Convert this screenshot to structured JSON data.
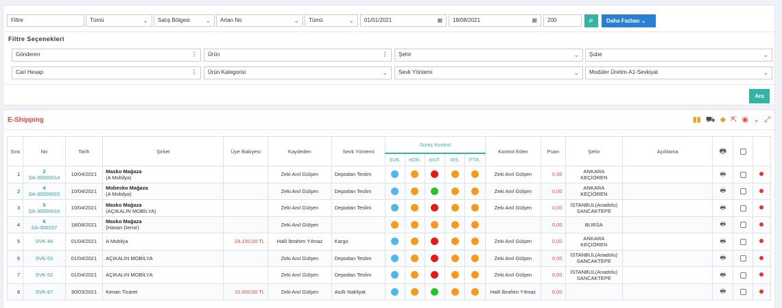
{
  "filters": {
    "text1": "Filtre",
    "all1": "Tümü",
    "region": "Satış Bölgesi",
    "sort": "Artan No",
    "all2": "Tümü",
    "date_from": "01/01/2021",
    "date_to": "18/08/2021",
    "limit": "200",
    "more_label": "Daha Fazlası",
    "search_icon": "search-icon"
  },
  "options": {
    "title": "Filtre Seçenekleri",
    "sender": "Gönderen",
    "product": "Ürün",
    "city": "Şehir",
    "branch": "Şube",
    "account": "Cari Hesap",
    "product_category": "Ürün Kategorisi",
    "shipping_method": "Sevk Yöntemi",
    "module": "Modüler Üretim-A1-Sevkiyat",
    "search_label": "Ara"
  },
  "grid": {
    "title": "E-Shipping",
    "tool_icons": [
      "bar-chart-icon",
      "truck-icon",
      "eraser-icon",
      "export-icon",
      "eye-icon",
      "chevron-down-icon",
      "expand-icon"
    ],
    "headers": {
      "no_col": "Sıra",
      "id": "No",
      "date": "Tarih",
      "company": "Şirket",
      "balance": "Üye Bakiyesi",
      "recorder": "Kaydeden",
      "method": "Sevk Yöntemi",
      "process": "Süreç Kontrol",
      "svk": "SVK.",
      "hzr": "HZR.",
      "knt": "KNT.",
      "irs": "İRS.",
      "ftr": "FTR.",
      "controller": "Kontrol Eden",
      "score": "Puan",
      "city": "Şehir",
      "note": "Açıklama"
    },
    "status_colors": {
      "blue": "#4fb8e8",
      "orange": "#f59a1b",
      "red": "#e8171c",
      "green": "#29c12e"
    },
    "rows": [
      {
        "seq": "1",
        "num": "2",
        "code": "SA-30000014",
        "date": "10/04/2021",
        "company": "Masko Mağaza",
        "company_sub": "(A Mobilya)",
        "balance": "",
        "recorder": "Zeki Anıl Gülşen",
        "method": "Depodan Teslim",
        "dots": [
          "blue",
          "orange",
          "red",
          "orange",
          "orange"
        ],
        "controller": "Zeki Anıl Gülşen",
        "score": "0,00",
        "city1": "ANKARA",
        "city2": "KEÇİÖREN"
      },
      {
        "seq": "2",
        "num": "4",
        "code": "SA-30000015",
        "date": "10/04/2021",
        "company": "Mobesko Mağaza",
        "company_sub": "(A Mobilya)",
        "balance": "",
        "recorder": "Zeki Anıl Gülşen",
        "method": "Depodan Teslim",
        "dots": [
          "blue",
          "orange",
          "green",
          "orange",
          "orange"
        ],
        "controller": "Zeki Anıl Gülşen",
        "score": "0,00",
        "city1": "ANKARA",
        "city2": "KEÇİÖREN"
      },
      {
        "seq": "3",
        "num": "5",
        "code": "SA-30000016",
        "date": "10/04/2021",
        "company": "Masko Mağaza",
        "company_sub": "(AÇIKALIN MOBİLYA)",
        "balance": "",
        "recorder": "Zeki Anıl Gülşen",
        "method": "Depodan Teslim",
        "dots": [
          "blue",
          "orange",
          "red",
          "orange",
          "orange"
        ],
        "controller": "Zeki Anıl Gülşen",
        "score": "0,00",
        "city1": "İSTANBUL(Anadolu)",
        "city2": "SANCAKTEPE"
      },
      {
        "seq": "4",
        "num": "6",
        "code": "SA-300107",
        "date": "18/08/2021",
        "company": "Masko Mağaza",
        "company_sub": "(Hasan Demir)",
        "balance": "",
        "recorder": "Zeki Anıl Gülşen",
        "method": "",
        "dots": [
          "orange",
          "orange",
          "orange",
          "orange",
          "orange"
        ],
        "controller": "",
        "score": "0,00",
        "city1": "BURSA",
        "city2": ""
      },
      {
        "seq": "5",
        "num": "",
        "code": "SVK-44",
        "date": "01/04/2021",
        "company": "",
        "company_sub": "A Mobilya",
        "balance": "28.150,00 TL",
        "recorder": "Halil İbrahim Yılmaz",
        "method": "Kargo",
        "dots": [
          "blue",
          "orange",
          "red",
          "orange",
          "orange"
        ],
        "controller": "Zeki Anıl Gülşen",
        "score": "0,00",
        "city1": "ANKARA",
        "city2": "KEÇİÖREN"
      },
      {
        "seq": "6",
        "num": "",
        "code": "SVK-51",
        "date": "01/04/2021",
        "company": "",
        "company_sub": "AÇIKALIN MOBİLYA",
        "balance": "",
        "recorder": "Zeki Anıl Gülşen",
        "method": "Depodan Teslim",
        "dots": [
          "blue",
          "orange",
          "red",
          "orange",
          "orange"
        ],
        "controller": "Zeki Anıl Gülşen",
        "score": "0,00",
        "city1": "İSTANBUL(Anadolu)",
        "city2": "SANCAKTEPE"
      },
      {
        "seq": "7",
        "num": "",
        "code": "SVK-52",
        "date": "01/04/2021",
        "company": "",
        "company_sub": "AÇIKALIN MOBİLYA",
        "balance": "",
        "recorder": "Zeki Anıl Gülşen",
        "method": "Depodan Teslim",
        "dots": [
          "blue",
          "orange",
          "red",
          "orange",
          "orange"
        ],
        "controller": "Zeki Anıl Gülşen",
        "score": "0,00",
        "city1": "İSTANBUL(Anadolu)",
        "city2": "SANCAKTEPE"
      },
      {
        "seq": "8",
        "num": "",
        "code": "SVK-67",
        "date": "30/03/2021",
        "company": "",
        "company_sub": "Kenan Ticaret",
        "balance": "10.000,00 TL",
        "recorder": "Zeki Anıl Gülşen",
        "method": "Asıllı Nakliyat",
        "dots": [
          "blue",
          "orange",
          "green",
          "orange",
          "orange"
        ],
        "controller": "Halil İbrahim Yılmaz",
        "score": "0,00",
        "city1": "",
        "city2": ""
      }
    ]
  }
}
